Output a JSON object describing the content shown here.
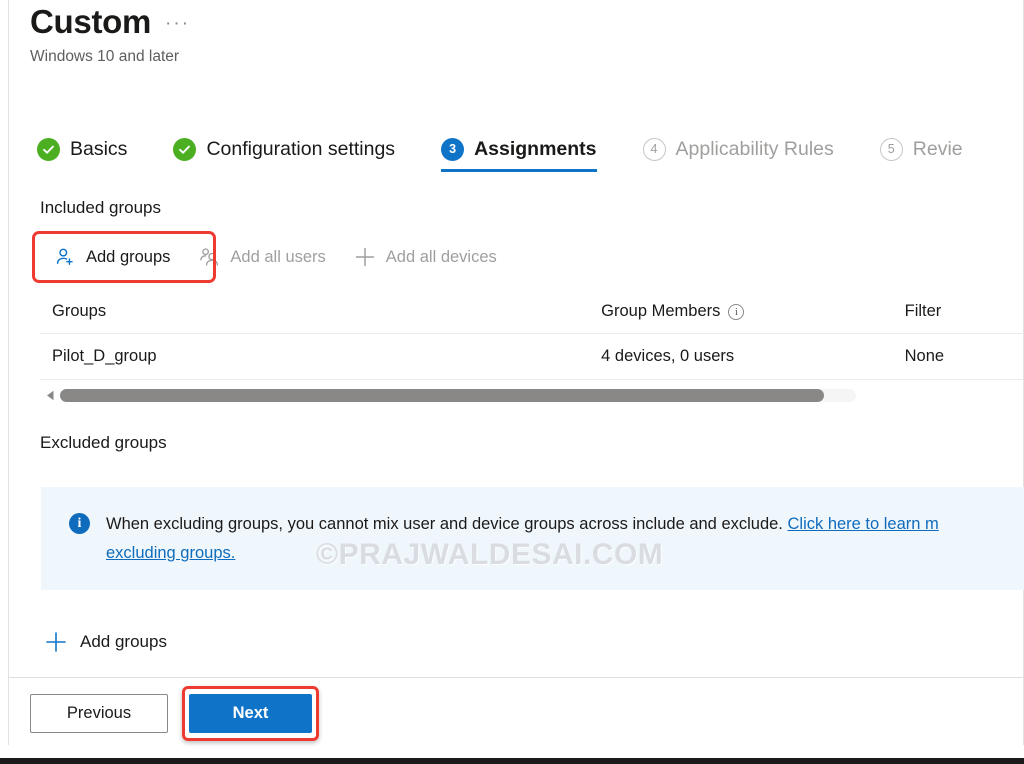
{
  "header": {
    "title": "Custom",
    "subtitle": "Windows 10 and later",
    "ellipsis": "···"
  },
  "wizard": {
    "tabs": [
      {
        "badge": "✓",
        "label": "Basics",
        "state": "completed"
      },
      {
        "badge": "✓",
        "label": "Configuration settings",
        "state": "completed"
      },
      {
        "badge": "3",
        "label": "Assignments",
        "state": "active"
      },
      {
        "badge": "4",
        "label": "Applicability Rules",
        "state": "todo"
      },
      {
        "badge": "5",
        "label": "Revie",
        "state": "todo"
      }
    ]
  },
  "included": {
    "heading": "Included groups",
    "commands": [
      {
        "label": "Add groups",
        "icon": "add-user-icon",
        "disabled": false
      },
      {
        "label": "Add all users",
        "icon": "users-icon",
        "disabled": true
      },
      {
        "label": "Add all devices",
        "icon": "plus-icon",
        "disabled": true
      }
    ],
    "table": {
      "columns": [
        "Groups",
        "Group Members",
        "Filter"
      ],
      "members_info_icon": "i",
      "rows": [
        {
          "group": "Pilot_D_group",
          "members": "4 devices, 0 users",
          "filter": "None"
        }
      ]
    }
  },
  "excluded": {
    "heading": "Excluded groups",
    "banner": {
      "icon": "i",
      "text_before_link": "When excluding groups, you cannot mix user and device groups across include and exclude. ",
      "link_text": "Click here to learn m",
      "link_text_second_line": "excluding groups."
    },
    "add_groups_label": "Add groups"
  },
  "watermark": "©PRAJWALDESAI.COM",
  "footer": {
    "previous_label": "Previous",
    "next_label": "Next"
  },
  "colors": {
    "accent_blue": "#0f74c8",
    "completed_green": "#4caf22",
    "banner_bg": "#eff6fc",
    "highlight_red": "#ee3b32",
    "link_blue": "#0f6cbd"
  }
}
